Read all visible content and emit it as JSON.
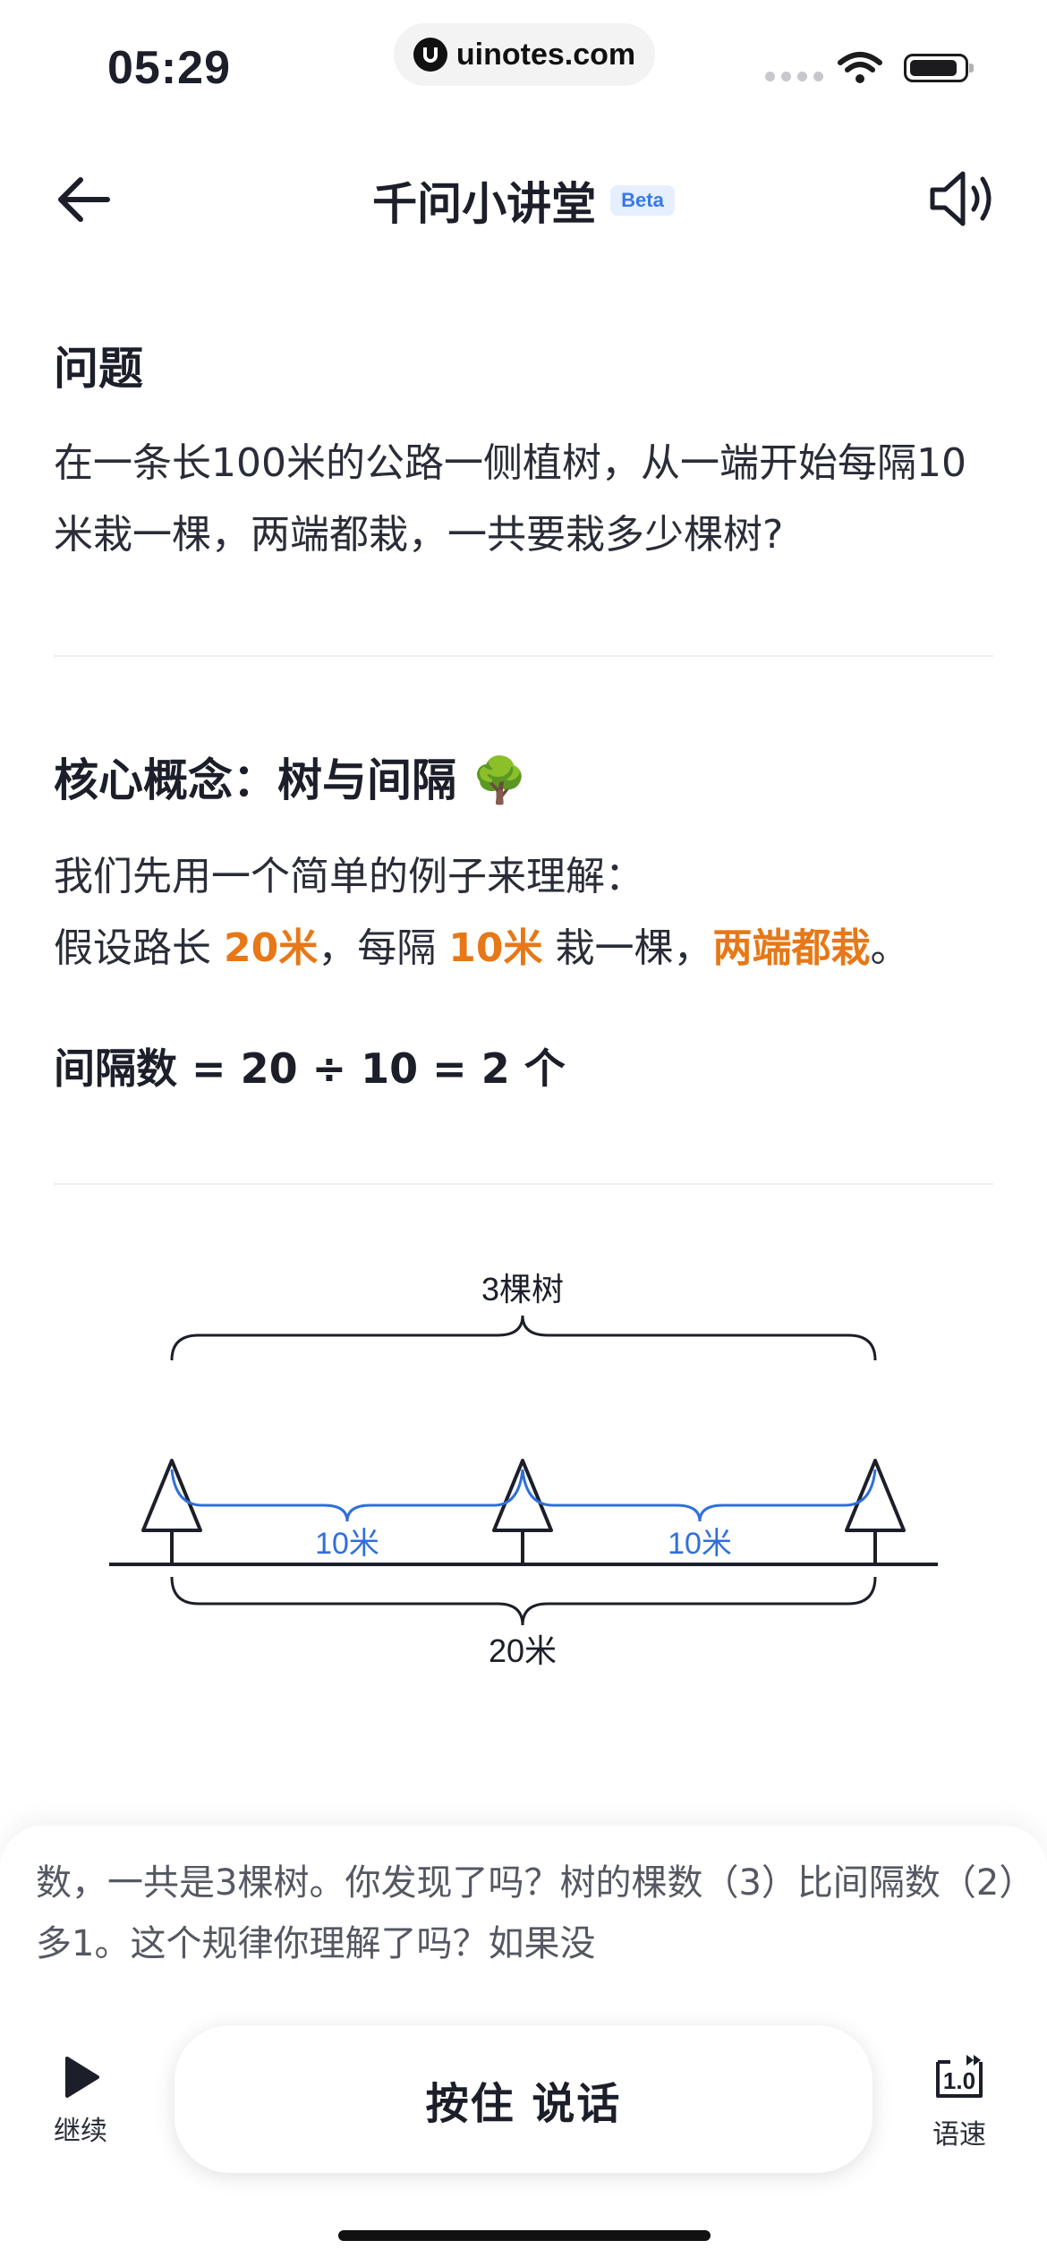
{
  "status": {
    "time": "05:29",
    "url": "uinotes.com"
  },
  "nav": {
    "title": "千问小讲堂",
    "badge": "Beta"
  },
  "question": {
    "title": "问题",
    "text": "在一条长100米的公路一侧植树，从一端开始每隔10米栽一棵，两端都栽，一共要栽多少棵树?"
  },
  "concept": {
    "title": "核心概念：树与间隔 🌳",
    "line1": "我们先用一个简单的例子来理解：",
    "line2_a": "假设路长 ",
    "line2_b": "20米",
    "line2_c": "，每隔 ",
    "line2_d": "10米",
    "line2_e": " 栽一棵，",
    "line2_f": "两端都栽",
    "line2_g": "。",
    "formula": "间隔数 = 20 ÷ 10 = 2 个"
  },
  "diagram": {
    "top_label": "3棵树",
    "interval_labels": [
      "10米",
      "10米"
    ],
    "bottom_label": "20米",
    "colors": {
      "interval": "#2f6fdb",
      "line": "#1c1f2a"
    }
  },
  "transcript": {
    "text": "数，一共是3棵树。你发现了吗？树的棵数（3）比间隔数（2）多1。这个规律你理解了吗？如果没"
  },
  "controls": {
    "continue_label": "继续",
    "talk_label": "按住 说话",
    "speed_value": "1.0",
    "speed_label": "语速"
  }
}
